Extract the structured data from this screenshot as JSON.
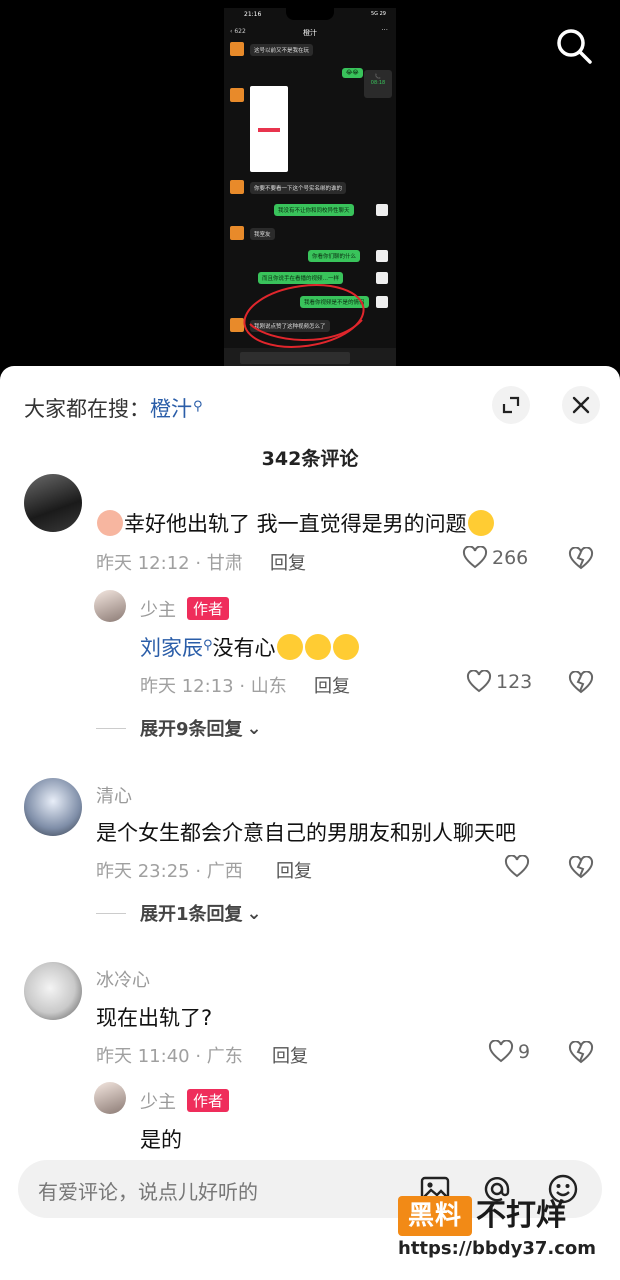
{
  "video": {
    "phone_time": "21:16",
    "phone_signal": "5G",
    "phone_battery": "29",
    "chat_back_count": "622",
    "chat_title": "橙汁",
    "messages_in": [
      "这号以前又不是我在玩",
      "你要不要看一下这个号实名绑的谁的",
      "我室友",
      "我刚说点赞了这种视频怎么了"
    ],
    "messages_out": [
      "我没有不让你和同校异性聊天",
      "你看你们聊的什么",
      "而且你说手在看播的视频…一样",
      "我看你视频是不是的情侣"
    ],
    "call_label": "08:18"
  },
  "sheet": {
    "trend_prefix": "大家都在搜：",
    "trend_term": "橙汁",
    "comment_count": "342条评论",
    "composer_placeholder": "有爱评论，说点儿好听的"
  },
  "comments": [
    {
      "text": "幸好他出轨了 我一直觉得是男的问题",
      "time": "昨天 12:12 · 甘肃",
      "reply_label": "回复",
      "likes": "266"
    },
    {
      "username": "清心",
      "text": "是个女生都会介意自己的男朋友和别人聊天吧",
      "time": "昨天 23:25 · 广西",
      "reply_label": "回复",
      "likes": "",
      "expand": "展开1条回复"
    },
    {
      "username": "冰冷心",
      "text": "现在出轨了?",
      "time": "昨天 11:40 · 广东",
      "reply_label": "回复",
      "likes": "9"
    }
  ],
  "replies": [
    {
      "username": "少主",
      "badge": "作者",
      "mention": "刘家辰",
      "text": "没有心",
      "time": "昨天 12:13 · 山东",
      "reply_label": "回复",
      "likes": "123",
      "expand": "展开9条回复"
    },
    {
      "username": "少主",
      "badge": "作者",
      "text": "是的"
    }
  ],
  "watermark": {
    "box": "黑料",
    "text": "不打烊",
    "url": "https://bbdy37.com"
  },
  "colors": {
    "link_blue": "#2a5da8",
    "author_badge": "#ef2d5b",
    "watermark_orange": "#f28a16"
  }
}
